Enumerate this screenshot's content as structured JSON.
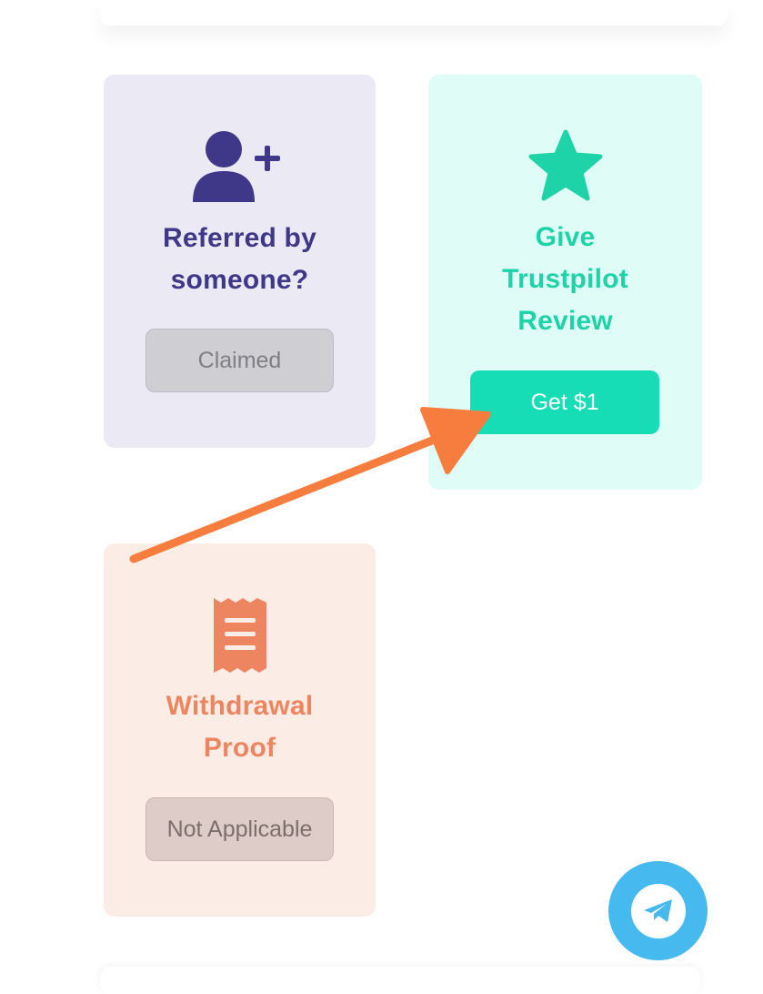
{
  "cards": {
    "referral": {
      "icon": "user-plus-icon",
      "title_line1": "Referred by",
      "title_line2": "someone?",
      "button_label": "Claimed",
      "accent": "#3f3788",
      "background": "#ebe9f4"
    },
    "trustpilot": {
      "icon": "star-icon",
      "title_line1": "Give",
      "title_line2": "Trustpilot",
      "title_line3": "Review",
      "button_label": "Get $1",
      "accent": "#1fd3a8",
      "background": "#e0fcf7"
    },
    "withdrawal": {
      "icon": "receipt-icon",
      "title_line1": "Withdrawal",
      "title_line2": "Proof",
      "button_label": "Not Applicable",
      "accent": "#ed8560",
      "background": "#fcece6"
    }
  },
  "fab": {
    "icon": "telegram-icon",
    "color": "#46b9ef"
  },
  "annotation": {
    "icon": "arrow-icon",
    "color": "#f77d3f"
  }
}
